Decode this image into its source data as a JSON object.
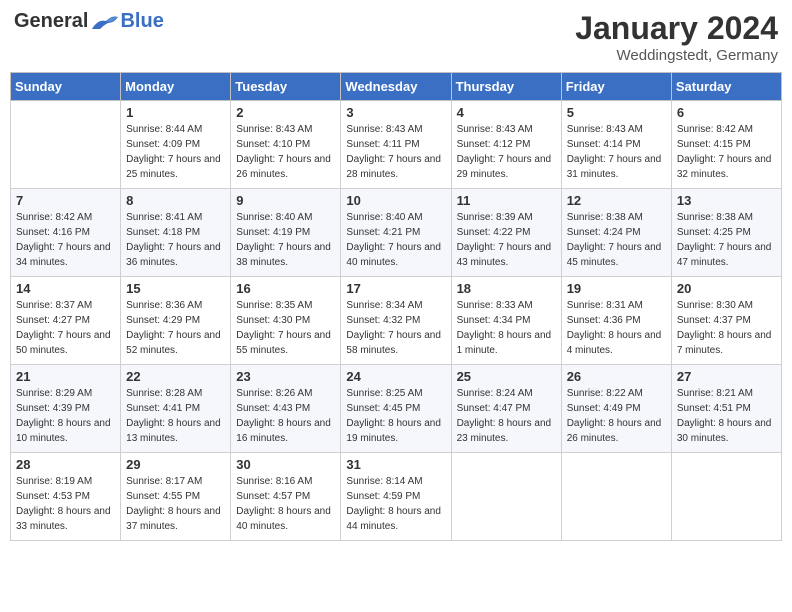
{
  "header": {
    "logo_general": "General",
    "logo_blue": "Blue",
    "month_title": "January 2024",
    "location": "Weddingstedt, Germany"
  },
  "days_of_week": [
    "Sunday",
    "Monday",
    "Tuesday",
    "Wednesday",
    "Thursday",
    "Friday",
    "Saturday"
  ],
  "weeks": [
    [
      {
        "day": "",
        "sunrise": "",
        "sunset": "",
        "daylight": ""
      },
      {
        "day": "1",
        "sunrise": "Sunrise: 8:44 AM",
        "sunset": "Sunset: 4:09 PM",
        "daylight": "Daylight: 7 hours and 25 minutes."
      },
      {
        "day": "2",
        "sunrise": "Sunrise: 8:43 AM",
        "sunset": "Sunset: 4:10 PM",
        "daylight": "Daylight: 7 hours and 26 minutes."
      },
      {
        "day": "3",
        "sunrise": "Sunrise: 8:43 AM",
        "sunset": "Sunset: 4:11 PM",
        "daylight": "Daylight: 7 hours and 28 minutes."
      },
      {
        "day": "4",
        "sunrise": "Sunrise: 8:43 AM",
        "sunset": "Sunset: 4:12 PM",
        "daylight": "Daylight: 7 hours and 29 minutes."
      },
      {
        "day": "5",
        "sunrise": "Sunrise: 8:43 AM",
        "sunset": "Sunset: 4:14 PM",
        "daylight": "Daylight: 7 hours and 31 minutes."
      },
      {
        "day": "6",
        "sunrise": "Sunrise: 8:42 AM",
        "sunset": "Sunset: 4:15 PM",
        "daylight": "Daylight: 7 hours and 32 minutes."
      }
    ],
    [
      {
        "day": "7",
        "sunrise": "Sunrise: 8:42 AM",
        "sunset": "Sunset: 4:16 PM",
        "daylight": "Daylight: 7 hours and 34 minutes."
      },
      {
        "day": "8",
        "sunrise": "Sunrise: 8:41 AM",
        "sunset": "Sunset: 4:18 PM",
        "daylight": "Daylight: 7 hours and 36 minutes."
      },
      {
        "day": "9",
        "sunrise": "Sunrise: 8:40 AM",
        "sunset": "Sunset: 4:19 PM",
        "daylight": "Daylight: 7 hours and 38 minutes."
      },
      {
        "day": "10",
        "sunrise": "Sunrise: 8:40 AM",
        "sunset": "Sunset: 4:21 PM",
        "daylight": "Daylight: 7 hours and 40 minutes."
      },
      {
        "day": "11",
        "sunrise": "Sunrise: 8:39 AM",
        "sunset": "Sunset: 4:22 PM",
        "daylight": "Daylight: 7 hours and 43 minutes."
      },
      {
        "day": "12",
        "sunrise": "Sunrise: 8:38 AM",
        "sunset": "Sunset: 4:24 PM",
        "daylight": "Daylight: 7 hours and 45 minutes."
      },
      {
        "day": "13",
        "sunrise": "Sunrise: 8:38 AM",
        "sunset": "Sunset: 4:25 PM",
        "daylight": "Daylight: 7 hours and 47 minutes."
      }
    ],
    [
      {
        "day": "14",
        "sunrise": "Sunrise: 8:37 AM",
        "sunset": "Sunset: 4:27 PM",
        "daylight": "Daylight: 7 hours and 50 minutes."
      },
      {
        "day": "15",
        "sunrise": "Sunrise: 8:36 AM",
        "sunset": "Sunset: 4:29 PM",
        "daylight": "Daylight: 7 hours and 52 minutes."
      },
      {
        "day": "16",
        "sunrise": "Sunrise: 8:35 AM",
        "sunset": "Sunset: 4:30 PM",
        "daylight": "Daylight: 7 hours and 55 minutes."
      },
      {
        "day": "17",
        "sunrise": "Sunrise: 8:34 AM",
        "sunset": "Sunset: 4:32 PM",
        "daylight": "Daylight: 7 hours and 58 minutes."
      },
      {
        "day": "18",
        "sunrise": "Sunrise: 8:33 AM",
        "sunset": "Sunset: 4:34 PM",
        "daylight": "Daylight: 8 hours and 1 minute."
      },
      {
        "day": "19",
        "sunrise": "Sunrise: 8:31 AM",
        "sunset": "Sunset: 4:36 PM",
        "daylight": "Daylight: 8 hours and 4 minutes."
      },
      {
        "day": "20",
        "sunrise": "Sunrise: 8:30 AM",
        "sunset": "Sunset: 4:37 PM",
        "daylight": "Daylight: 8 hours and 7 minutes."
      }
    ],
    [
      {
        "day": "21",
        "sunrise": "Sunrise: 8:29 AM",
        "sunset": "Sunset: 4:39 PM",
        "daylight": "Daylight: 8 hours and 10 minutes."
      },
      {
        "day": "22",
        "sunrise": "Sunrise: 8:28 AM",
        "sunset": "Sunset: 4:41 PM",
        "daylight": "Daylight: 8 hours and 13 minutes."
      },
      {
        "day": "23",
        "sunrise": "Sunrise: 8:26 AM",
        "sunset": "Sunset: 4:43 PM",
        "daylight": "Daylight: 8 hours and 16 minutes."
      },
      {
        "day": "24",
        "sunrise": "Sunrise: 8:25 AM",
        "sunset": "Sunset: 4:45 PM",
        "daylight": "Daylight: 8 hours and 19 minutes."
      },
      {
        "day": "25",
        "sunrise": "Sunrise: 8:24 AM",
        "sunset": "Sunset: 4:47 PM",
        "daylight": "Daylight: 8 hours and 23 minutes."
      },
      {
        "day": "26",
        "sunrise": "Sunrise: 8:22 AM",
        "sunset": "Sunset: 4:49 PM",
        "daylight": "Daylight: 8 hours and 26 minutes."
      },
      {
        "day": "27",
        "sunrise": "Sunrise: 8:21 AM",
        "sunset": "Sunset: 4:51 PM",
        "daylight": "Daylight: 8 hours and 30 minutes."
      }
    ],
    [
      {
        "day": "28",
        "sunrise": "Sunrise: 8:19 AM",
        "sunset": "Sunset: 4:53 PM",
        "daylight": "Daylight: 8 hours and 33 minutes."
      },
      {
        "day": "29",
        "sunrise": "Sunrise: 8:17 AM",
        "sunset": "Sunset: 4:55 PM",
        "daylight": "Daylight: 8 hours and 37 minutes."
      },
      {
        "day": "30",
        "sunrise": "Sunrise: 8:16 AM",
        "sunset": "Sunset: 4:57 PM",
        "daylight": "Daylight: 8 hours and 40 minutes."
      },
      {
        "day": "31",
        "sunrise": "Sunrise: 8:14 AM",
        "sunset": "Sunset: 4:59 PM",
        "daylight": "Daylight: 8 hours and 44 minutes."
      },
      {
        "day": "",
        "sunrise": "",
        "sunset": "",
        "daylight": ""
      },
      {
        "day": "",
        "sunrise": "",
        "sunset": "",
        "daylight": ""
      },
      {
        "day": "",
        "sunrise": "",
        "sunset": "",
        "daylight": ""
      }
    ]
  ]
}
